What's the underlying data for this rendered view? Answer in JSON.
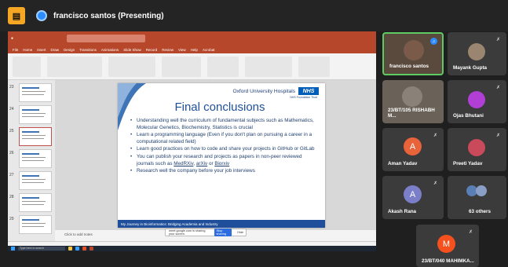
{
  "topbar": {
    "app_icon": "presentation-icon",
    "title": "francisco santos (Presenting)"
  },
  "ppt": {
    "tabs": [
      "File",
      "Home",
      "Insert",
      "Draw",
      "Design",
      "Transitions",
      "Animations",
      "Slide Show",
      "Record",
      "Review",
      "View",
      "Help",
      "Acrobat"
    ],
    "notes_placeholder": "Click to add notes"
  },
  "slide": {
    "org": "Oxford University Hospitals",
    "badge": "NHS",
    "trust": "NHS Foundation Trust",
    "title": "Final conclusions",
    "bullets": [
      {
        "pre": "Understanding well the curriculum of fundamental subjects such as Mathematics, Molecular Genetics, Biochemistry, Statistics is crucial"
      },
      {
        "pre": "Learn a programming language (Even if you don't plan on pursuing a career in a computational related field)"
      },
      {
        "pre": "Learn good practices on how to code and share your projects in GitHub or GitLab"
      },
      {
        "pre": "You can publish your research and projects as papers in non-peer reviewed journals such as ",
        "l1": "MedRXiv",
        "mid1": ", ",
        "l2": "arXiv",
        "mid2": " or ",
        "l3": "Biorxiv"
      },
      {
        "pre": "Research well the company before your job interviews"
      }
    ],
    "footer": "My Journey in Bioinformatics: Bridging Academia and Industry"
  },
  "sharing": {
    "text": "meet.google.com is sharing your screen.",
    "stop": "Stop sharing",
    "hide": "Hide"
  },
  "taskbar": {
    "search": "Type here to search"
  },
  "participants": [
    {
      "name": "francisco santos",
      "kind": "photo",
      "color": "#7a5a48"
    },
    {
      "name": "Mayank Gupta",
      "kind": "photo",
      "color": "#9a8670"
    },
    {
      "name": "23/BT/105 RISHABH M...",
      "kind": "photo",
      "color": "#6e6a62"
    },
    {
      "name": "Ojas Bhutani",
      "kind": "photo",
      "color": "#b13fd6"
    },
    {
      "name": "Aman Yadav",
      "kind": "letter",
      "letter": "A",
      "color": "#e8623a"
    },
    {
      "name": "Preeti Yadav",
      "kind": "photo",
      "color": "#c94a5a"
    },
    {
      "name": "Akash Rana",
      "kind": "letter",
      "letter": "A",
      "color": "#7b7fc9"
    },
    {
      "name": "63 others",
      "kind": "group",
      "color": "#5a7fb5"
    },
    {
      "name": "23/BT/040 MAHIMKA...",
      "kind": "letter",
      "letter": "M",
      "color": "#f4511e"
    }
  ]
}
